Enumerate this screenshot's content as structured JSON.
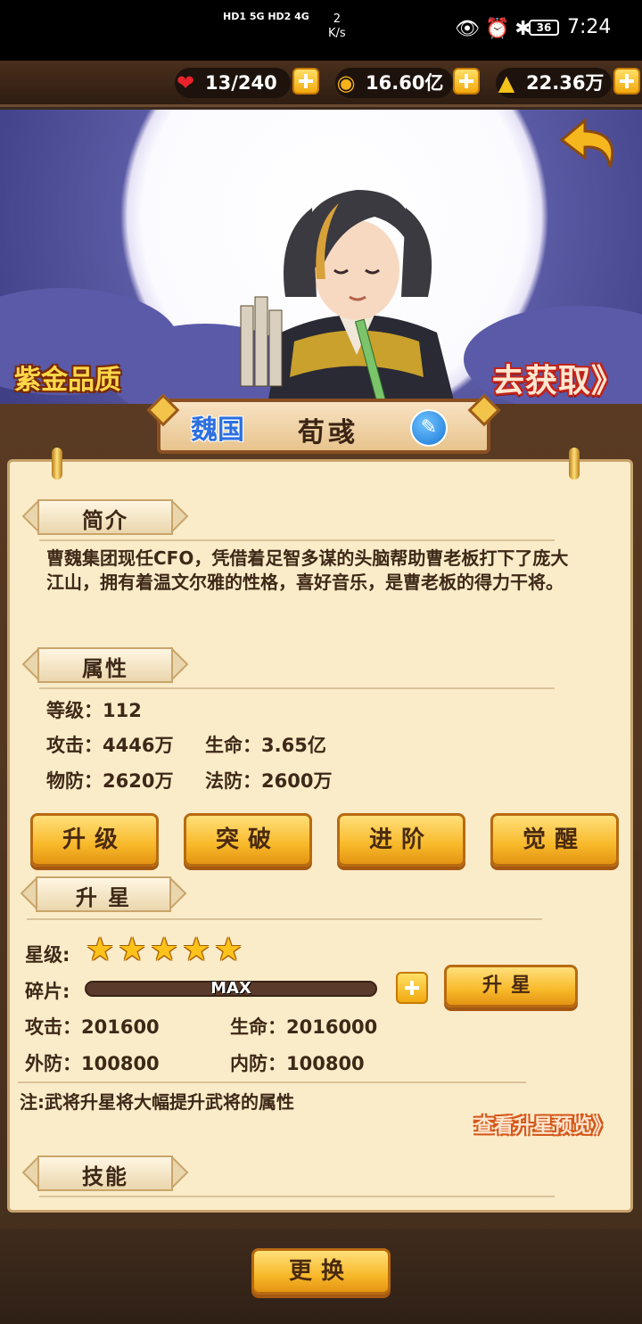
{
  "status_bar": {
    "signal": "HD1 5G HD2 4G",
    "speed_value": "2",
    "speed_unit": "K/s",
    "battery": "36",
    "time": "7:24"
  },
  "resources": {
    "stamina": "13/240",
    "coins": "16.60亿",
    "gold": "22.36万"
  },
  "hero": {
    "quality": "紫金品质",
    "obtain": "去获取》",
    "kingdom": "魏国",
    "name": "荀彧"
  },
  "intro": {
    "header": "简介",
    "text": "曹魏集团现任CFO，凭借着足智多谋的头脑帮助曹老板打下了庞大江山，拥有着温文尔雅的性格，喜好音乐，是曹老板的得力干将。"
  },
  "attributes": {
    "header": "属性",
    "level": "等级：112",
    "attack": "攻击：4446万",
    "hp": "生命：3.65亿",
    "phys_def": "物防：2620万",
    "magic_def": "法防：2600万"
  },
  "actions": {
    "upgrade": "升级",
    "breakthrough": "突破",
    "advance": "进阶",
    "awaken": "觉醒"
  },
  "star_up": {
    "header": "升 星",
    "star_label": "星级:",
    "stars": 5,
    "shard_label": "碎片:",
    "shard_progress": "MAX",
    "button": "升星",
    "attack": "攻击：201600",
    "hp": "生命：2016000",
    "outer_def": "外防：100800",
    "inner_def": "内防：100800",
    "note": "注:武将升星将大幅提升武将的属性",
    "preview": "查看升星预览》"
  },
  "skills": {
    "header": "技能"
  },
  "bottom": {
    "swap": "更换"
  }
}
